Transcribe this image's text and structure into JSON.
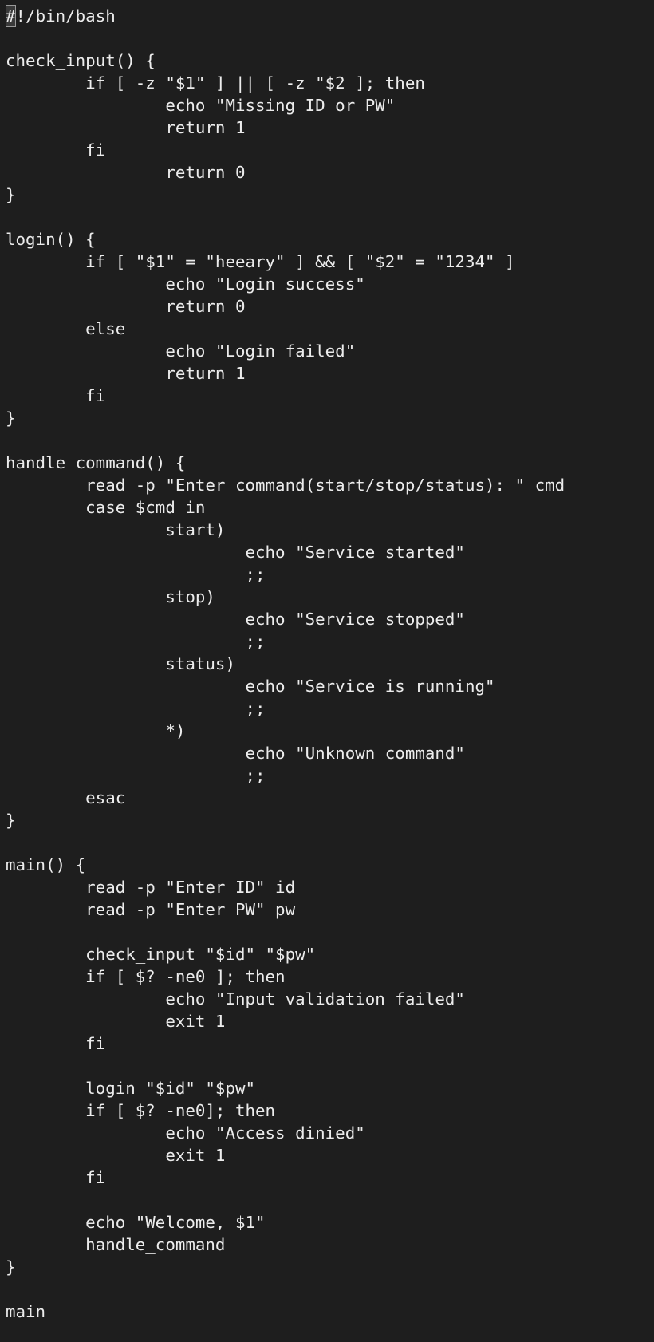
{
  "editor": {
    "cursor_char": "#",
    "first_line_rest": "!/bin/bash",
    "lines": [
      "",
      "check_input() {",
      "        if [ -z \"$1\" ] || [ -z \"$2 ]; then",
      "                echo \"Missing ID or PW\"",
      "                return 1",
      "        fi",
      "                return 0",
      "}",
      "",
      "login() {",
      "        if [ \"$1\" = \"heeary\" ] && [ \"$2\" = \"1234\" ]",
      "                echo \"Login success\"",
      "                return 0",
      "        else",
      "                echo \"Login failed\"",
      "                return 1",
      "        fi",
      "}",
      "",
      "handle_command() {",
      "        read -p \"Enter command(start/stop/status): \" cmd",
      "        case $cmd in",
      "                start)",
      "                        echo \"Service started\"",
      "                        ;;",
      "                stop)",
      "                        echo \"Service stopped\"",
      "                        ;;",
      "                status)",
      "                        echo \"Service is running\"",
      "                        ;;",
      "                *)",
      "                        echo \"Unknown command\"",
      "                        ;;",
      "        esac",
      "}",
      "",
      "main() {",
      "        read -p \"Enter ID\" id",
      "        read -p \"Enter PW\" pw",
      "",
      "        check_input \"$id\" \"$pw\"",
      "        if [ $? -ne0 ]; then",
      "                echo \"Input validation failed\"",
      "                exit 1",
      "        fi",
      "",
      "        login \"$id\" \"$pw\"",
      "        if [ $? -ne0]; then",
      "                echo \"Access dinied\"",
      "                exit 1",
      "        fi",
      "",
      "        echo \"Welcome, $1\"",
      "        handle_command",
      "}",
      "",
      "main"
    ]
  }
}
